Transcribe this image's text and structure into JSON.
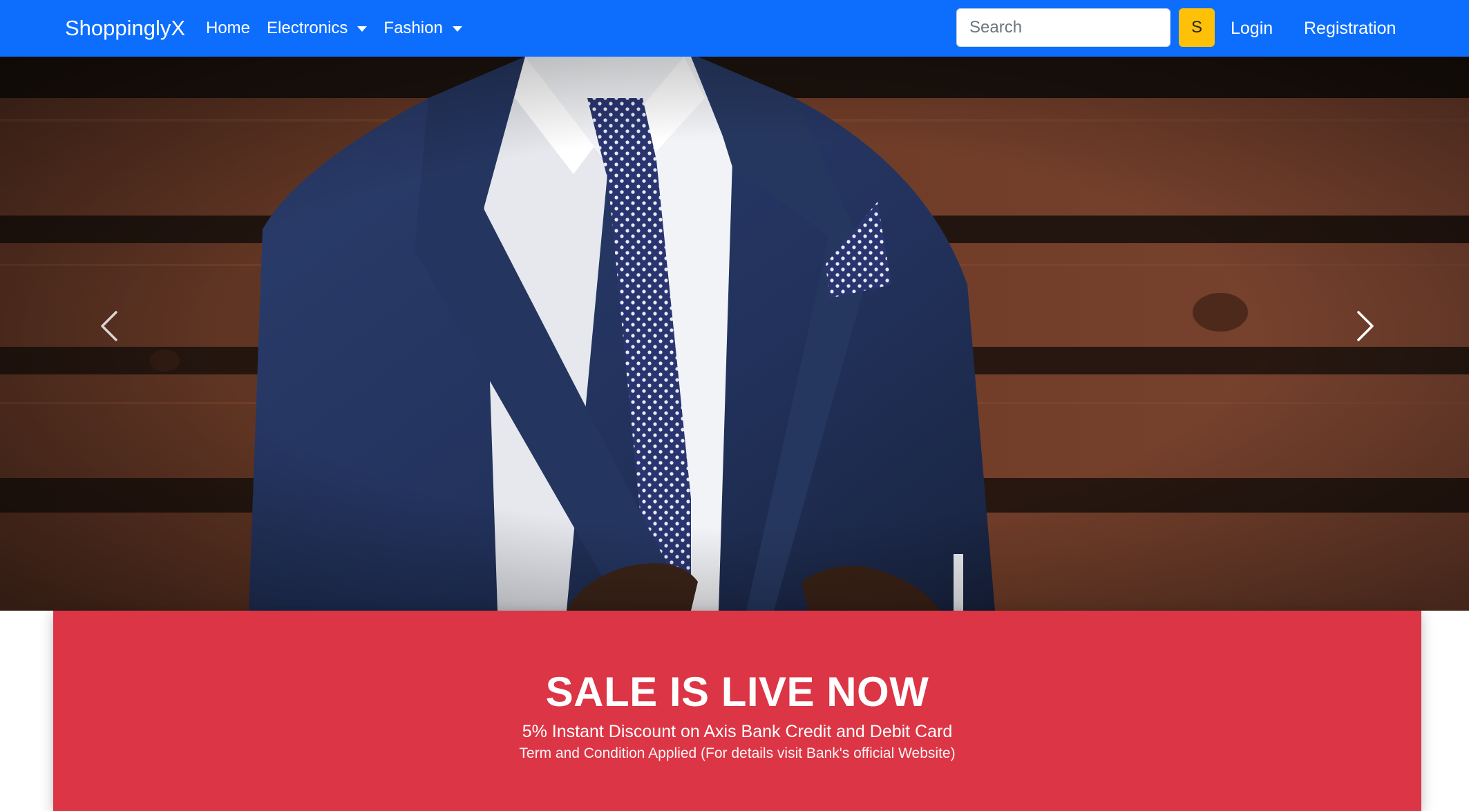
{
  "navbar": {
    "brand": "ShoppinglyX",
    "links": [
      {
        "label": "Home",
        "dropdown": false
      },
      {
        "label": "Electronics",
        "dropdown": true
      },
      {
        "label": "Fashion",
        "dropdown": true
      }
    ],
    "search": {
      "placeholder": "Search",
      "value": "",
      "button_label": "S"
    },
    "login_label": "Login",
    "register_label": "Registration",
    "colors": {
      "navbar_bg": "#0d6efd",
      "search_button_bg": "#ffc107"
    }
  },
  "carousel": {
    "image": "man-in-navy-suit-polka-dot-tie",
    "prev_icon": "chevron-left-icon",
    "next_icon": "chevron-right-icon"
  },
  "sale_banner": {
    "title": "SALE IS LIVE NOW",
    "subtitle": "5% Instant Discount on Axis Bank Credit and Debit Card",
    "terms": "Term and Condition Applied (For details visit Bank's official Website)",
    "background": "#dc3545"
  }
}
